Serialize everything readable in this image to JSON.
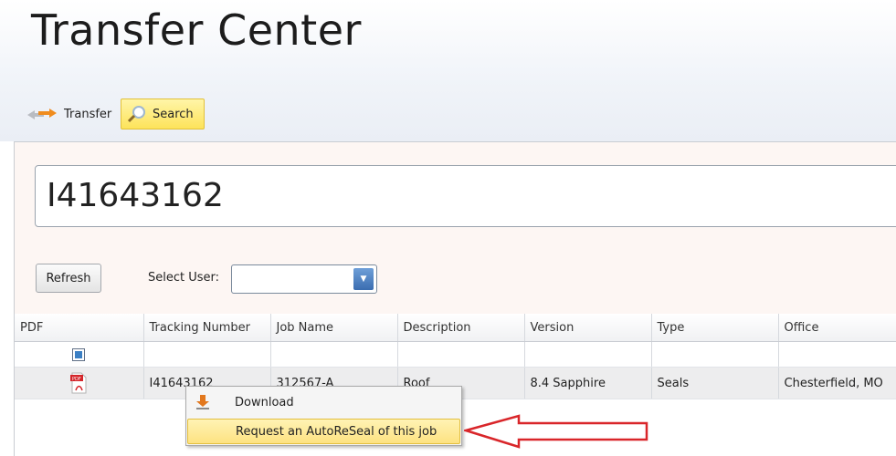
{
  "header": {
    "title": "Transfer Center"
  },
  "toolbar": {
    "transfer_label": "Transfer",
    "search_label": "Search"
  },
  "search": {
    "value": "I41643162"
  },
  "controls": {
    "refresh_label": "Refresh",
    "select_user_label": "Select User:",
    "select_user_value": ""
  },
  "grid": {
    "columns": [
      "PDF",
      "Tracking Number",
      "Job Name",
      "Description",
      "Version",
      "Type",
      "Office"
    ],
    "rows": [
      {
        "tracking": "I41643162",
        "job": "312567-A",
        "description": "Roof",
        "version": "8.4 Sapphire",
        "type": "Seals",
        "office": "Chesterfield, MO"
      }
    ]
  },
  "context_menu": {
    "download_label": "Download",
    "reseal_label": "Request an AutoReSeal of this job"
  },
  "colors": {
    "highlight": "#fde35a",
    "annotation_arrow": "#d9262a"
  },
  "icons": {
    "transfer": "transfer-arrows-icon",
    "search": "magnifier-icon",
    "pdf": "pdf-file-icon",
    "download": "download-icon"
  }
}
